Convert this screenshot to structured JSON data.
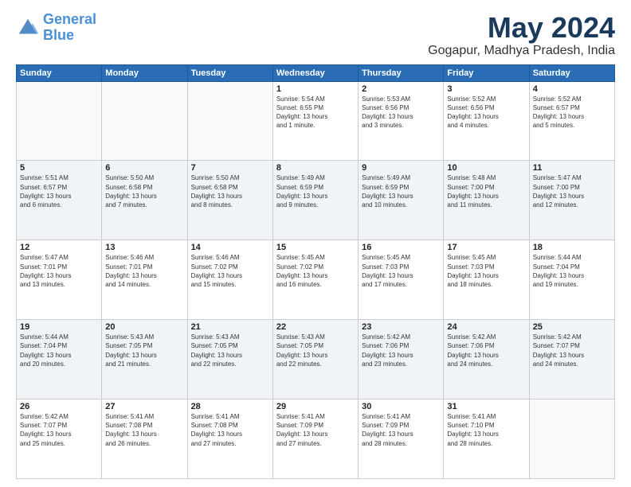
{
  "header": {
    "logo_line1": "General",
    "logo_line2": "Blue",
    "month_title": "May 2024",
    "location": "Gogapur, Madhya Pradesh, India"
  },
  "days_of_week": [
    "Sunday",
    "Monday",
    "Tuesday",
    "Wednesday",
    "Thursday",
    "Friday",
    "Saturday"
  ],
  "weeks": [
    [
      {
        "day": "",
        "info": ""
      },
      {
        "day": "",
        "info": ""
      },
      {
        "day": "",
        "info": ""
      },
      {
        "day": "1",
        "info": "Sunrise: 5:54 AM\nSunset: 6:55 PM\nDaylight: 13 hours\nand 1 minute."
      },
      {
        "day": "2",
        "info": "Sunrise: 5:53 AM\nSunset: 6:56 PM\nDaylight: 13 hours\nand 3 minutes."
      },
      {
        "day": "3",
        "info": "Sunrise: 5:52 AM\nSunset: 6:56 PM\nDaylight: 13 hours\nand 4 minutes."
      },
      {
        "day": "4",
        "info": "Sunrise: 5:52 AM\nSunset: 6:57 PM\nDaylight: 13 hours\nand 5 minutes."
      }
    ],
    [
      {
        "day": "5",
        "info": "Sunrise: 5:51 AM\nSunset: 6:57 PM\nDaylight: 13 hours\nand 6 minutes."
      },
      {
        "day": "6",
        "info": "Sunrise: 5:50 AM\nSunset: 6:58 PM\nDaylight: 13 hours\nand 7 minutes."
      },
      {
        "day": "7",
        "info": "Sunrise: 5:50 AM\nSunset: 6:58 PM\nDaylight: 13 hours\nand 8 minutes."
      },
      {
        "day": "8",
        "info": "Sunrise: 5:49 AM\nSunset: 6:59 PM\nDaylight: 13 hours\nand 9 minutes."
      },
      {
        "day": "9",
        "info": "Sunrise: 5:49 AM\nSunset: 6:59 PM\nDaylight: 13 hours\nand 10 minutes."
      },
      {
        "day": "10",
        "info": "Sunrise: 5:48 AM\nSunset: 7:00 PM\nDaylight: 13 hours\nand 11 minutes."
      },
      {
        "day": "11",
        "info": "Sunrise: 5:47 AM\nSunset: 7:00 PM\nDaylight: 13 hours\nand 12 minutes."
      }
    ],
    [
      {
        "day": "12",
        "info": "Sunrise: 5:47 AM\nSunset: 7:01 PM\nDaylight: 13 hours\nand 13 minutes."
      },
      {
        "day": "13",
        "info": "Sunrise: 5:46 AM\nSunset: 7:01 PM\nDaylight: 13 hours\nand 14 minutes."
      },
      {
        "day": "14",
        "info": "Sunrise: 5:46 AM\nSunset: 7:02 PM\nDaylight: 13 hours\nand 15 minutes."
      },
      {
        "day": "15",
        "info": "Sunrise: 5:45 AM\nSunset: 7:02 PM\nDaylight: 13 hours\nand 16 minutes."
      },
      {
        "day": "16",
        "info": "Sunrise: 5:45 AM\nSunset: 7:03 PM\nDaylight: 13 hours\nand 17 minutes."
      },
      {
        "day": "17",
        "info": "Sunrise: 5:45 AM\nSunset: 7:03 PM\nDaylight: 13 hours\nand 18 minutes."
      },
      {
        "day": "18",
        "info": "Sunrise: 5:44 AM\nSunset: 7:04 PM\nDaylight: 13 hours\nand 19 minutes."
      }
    ],
    [
      {
        "day": "19",
        "info": "Sunrise: 5:44 AM\nSunset: 7:04 PM\nDaylight: 13 hours\nand 20 minutes."
      },
      {
        "day": "20",
        "info": "Sunrise: 5:43 AM\nSunset: 7:05 PM\nDaylight: 13 hours\nand 21 minutes."
      },
      {
        "day": "21",
        "info": "Sunrise: 5:43 AM\nSunset: 7:05 PM\nDaylight: 13 hours\nand 22 minutes."
      },
      {
        "day": "22",
        "info": "Sunrise: 5:43 AM\nSunset: 7:05 PM\nDaylight: 13 hours\nand 22 minutes."
      },
      {
        "day": "23",
        "info": "Sunrise: 5:42 AM\nSunset: 7:06 PM\nDaylight: 13 hours\nand 23 minutes."
      },
      {
        "day": "24",
        "info": "Sunrise: 5:42 AM\nSunset: 7:06 PM\nDaylight: 13 hours\nand 24 minutes."
      },
      {
        "day": "25",
        "info": "Sunrise: 5:42 AM\nSunset: 7:07 PM\nDaylight: 13 hours\nand 24 minutes."
      }
    ],
    [
      {
        "day": "26",
        "info": "Sunrise: 5:42 AM\nSunset: 7:07 PM\nDaylight: 13 hours\nand 25 minutes."
      },
      {
        "day": "27",
        "info": "Sunrise: 5:41 AM\nSunset: 7:08 PM\nDaylight: 13 hours\nand 26 minutes."
      },
      {
        "day": "28",
        "info": "Sunrise: 5:41 AM\nSunset: 7:08 PM\nDaylight: 13 hours\nand 27 minutes."
      },
      {
        "day": "29",
        "info": "Sunrise: 5:41 AM\nSunset: 7:09 PM\nDaylight: 13 hours\nand 27 minutes."
      },
      {
        "day": "30",
        "info": "Sunrise: 5:41 AM\nSunset: 7:09 PM\nDaylight: 13 hours\nand 28 minutes."
      },
      {
        "day": "31",
        "info": "Sunrise: 5:41 AM\nSunset: 7:10 PM\nDaylight: 13 hours\nand 28 minutes."
      },
      {
        "day": "",
        "info": ""
      }
    ]
  ]
}
